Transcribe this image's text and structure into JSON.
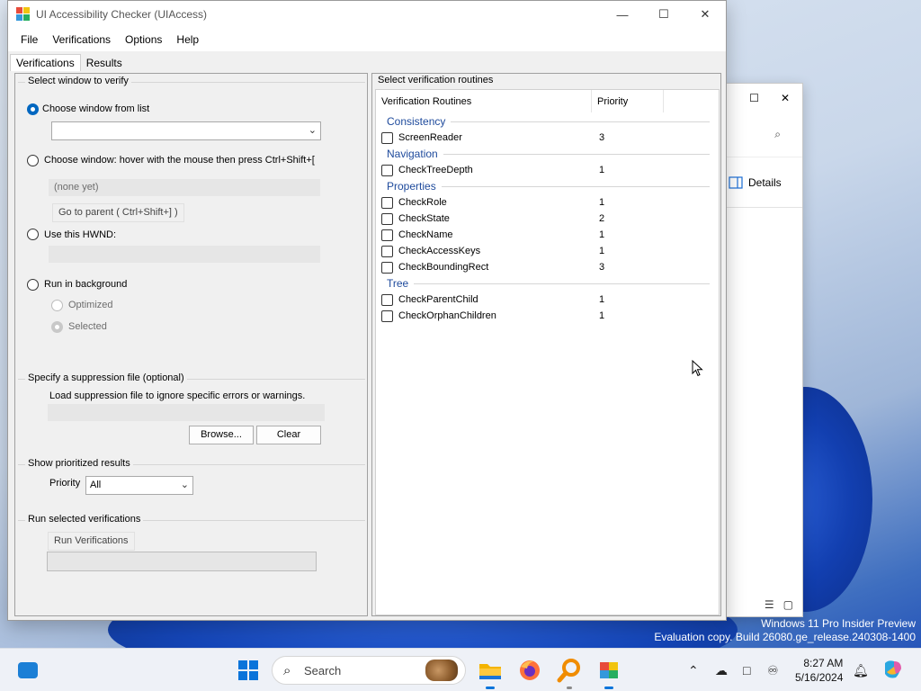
{
  "window": {
    "title": "UI Accessibility Checker (UIAccess)",
    "minimize_glyph": "—",
    "maximize_glyph": "☐",
    "close_glyph": "✕"
  },
  "menu": [
    "File",
    "Verifications",
    "Options",
    "Help"
  ],
  "tabs": [
    "Verifications",
    "Results"
  ],
  "select_window": {
    "title": "Select window to verify",
    "choose_from_list": "Choose window from list",
    "choose_hover": "Choose window: hover with the mouse then press Ctrl+Shift+[",
    "none_yet": "(none yet)",
    "go_to_parent": "Go to parent ( Ctrl+Shift+] )",
    "use_hwnd": "Use this HWND:",
    "run_background": "Run in background",
    "optimized": "Optimized",
    "selected": "Selected"
  },
  "suppression": {
    "title": "Specify a suppression file (optional)",
    "description": "Load suppression file to ignore specific errors or warnings.",
    "browse": "Browse...",
    "clear": "Clear"
  },
  "prioritized": {
    "title": "Show prioritized results",
    "priority_label": "Priority",
    "priority_value": "All"
  },
  "run": {
    "title": "Run selected verifications",
    "button": "Run Verifications",
    "progress": 0
  },
  "routines": {
    "title": "Select verification routines",
    "col_routines": "Verification Routines",
    "col_priority": "Priority",
    "groups": [
      {
        "name": "Consistency",
        "items": [
          {
            "name": "ScreenReader",
            "priority": "3"
          }
        ]
      },
      {
        "name": "Navigation",
        "items": [
          {
            "name": "CheckTreeDepth",
            "priority": "1"
          }
        ]
      },
      {
        "name": "Properties",
        "items": [
          {
            "name": "CheckRole",
            "priority": "1"
          },
          {
            "name": "CheckState",
            "priority": "2"
          },
          {
            "name": "CheckName",
            "priority": "1"
          },
          {
            "name": "CheckAccessKeys",
            "priority": "1"
          },
          {
            "name": "CheckBoundingRect",
            "priority": "3"
          }
        ]
      },
      {
        "name": "Tree",
        "items": [
          {
            "name": "CheckParentChild",
            "priority": "1"
          },
          {
            "name": "CheckOrphanChildren",
            "priority": "1"
          }
        ]
      }
    ]
  },
  "back_window": {
    "details": "Details"
  },
  "watermark": {
    "line1": "Windows 11 Pro Insider Preview",
    "line2": "Evaluation copy. Build 26080.ge_release.240308-1400"
  },
  "taskbar": {
    "search_placeholder": "Search",
    "time": "8:27 AM",
    "date": "5/16/2024",
    "icons": [
      "widgets-icon",
      "start-icon",
      "file-explorer-icon",
      "firefox-icon",
      "magnifier-icon",
      "uiaccess-icon"
    ]
  }
}
